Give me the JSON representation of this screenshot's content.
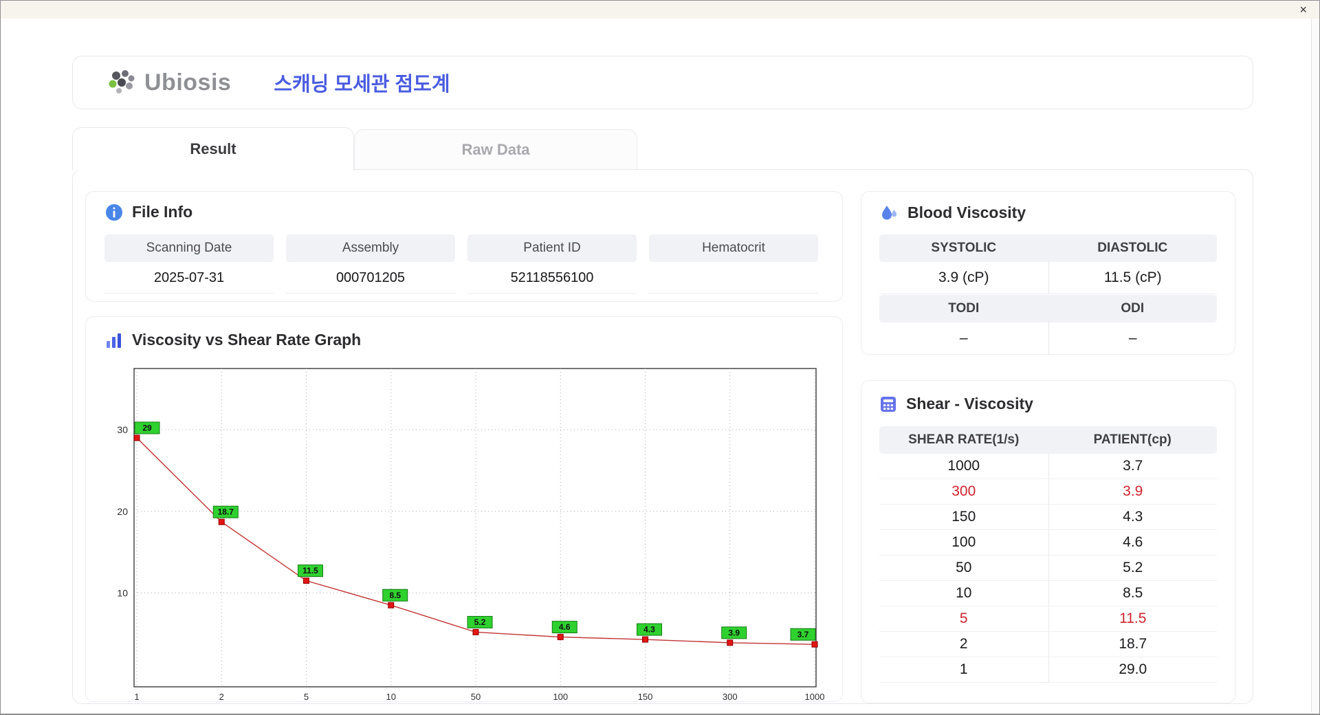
{
  "window": {
    "close_label": "×"
  },
  "header": {
    "brand": "Ubiosis",
    "title": "스캐닝 모세관 점도계",
    "title_color": "#4b5ce0"
  },
  "tabs": [
    {
      "label": "Result",
      "active": true
    },
    {
      "label": "Raw Data",
      "active": false
    }
  ],
  "file_info": {
    "title": "File Info",
    "fields": [
      {
        "label": "Scanning Date",
        "value": "2025-07-31"
      },
      {
        "label": "Assembly",
        "value": "000701205"
      },
      {
        "label": "Patient ID",
        "value": "52118556100"
      },
      {
        "label": "Hematocrit",
        "value": ""
      }
    ]
  },
  "graph": {
    "title": "Viscosity vs Shear Rate Graph"
  },
  "chart_data": {
    "type": "line",
    "title": "Viscosity vs Shear Rate Graph",
    "x": [
      "1",
      "2",
      "5",
      "10",
      "50",
      "100",
      "150",
      "300",
      "1000"
    ],
    "values": [
      29,
      18.7,
      11.5,
      8.5,
      5.2,
      4.6,
      4.3,
      3.9,
      3.7
    ],
    "point_labels": [
      "29",
      "18.7",
      "11.5",
      "8.5",
      "5.2",
      "4.6",
      "4.3",
      "3.9",
      "3.7"
    ],
    "yticks": [
      10,
      20,
      30
    ],
    "ylim": [
      -1.5,
      37.5
    ],
    "x_axis_style": "categorical-log-ticks",
    "grid": "dotted",
    "line_color": "#c23333",
    "marker_color": "#e41414",
    "marker_border": "#8c0000",
    "label_bg": "#2fd12f",
    "label_border": "#127a12"
  },
  "blood_viscosity": {
    "title": "Blood Viscosity",
    "systolic_label": "SYSTOLIC",
    "diastolic_label": "DIASTOLIC",
    "systolic_value": "3.9 (cP)",
    "diastolic_value": "11.5 (cP)",
    "todi_label": "TODI",
    "odi_label": "ODI",
    "todi_value": "–",
    "odi_value": "–"
  },
  "shear_table": {
    "title": "Shear - Viscosity",
    "columns": [
      "SHEAR RATE(1/s)",
      "PATIENT(cp)"
    ],
    "highlight_color": "#cf2430",
    "rows": [
      {
        "shear": "1000",
        "patient": "3.7",
        "highlight": false
      },
      {
        "shear": "300",
        "patient": "3.9",
        "highlight": true
      },
      {
        "shear": "150",
        "patient": "4.3",
        "highlight": false
      },
      {
        "shear": "100",
        "patient": "4.6",
        "highlight": false
      },
      {
        "shear": "50",
        "patient": "5.2",
        "highlight": false
      },
      {
        "shear": "10",
        "patient": "8.5",
        "highlight": false
      },
      {
        "shear": "5",
        "patient": "11.5",
        "highlight": true
      },
      {
        "shear": "2",
        "patient": "18.7",
        "highlight": false
      },
      {
        "shear": "1",
        "patient": "29.0",
        "highlight": false
      }
    ]
  }
}
